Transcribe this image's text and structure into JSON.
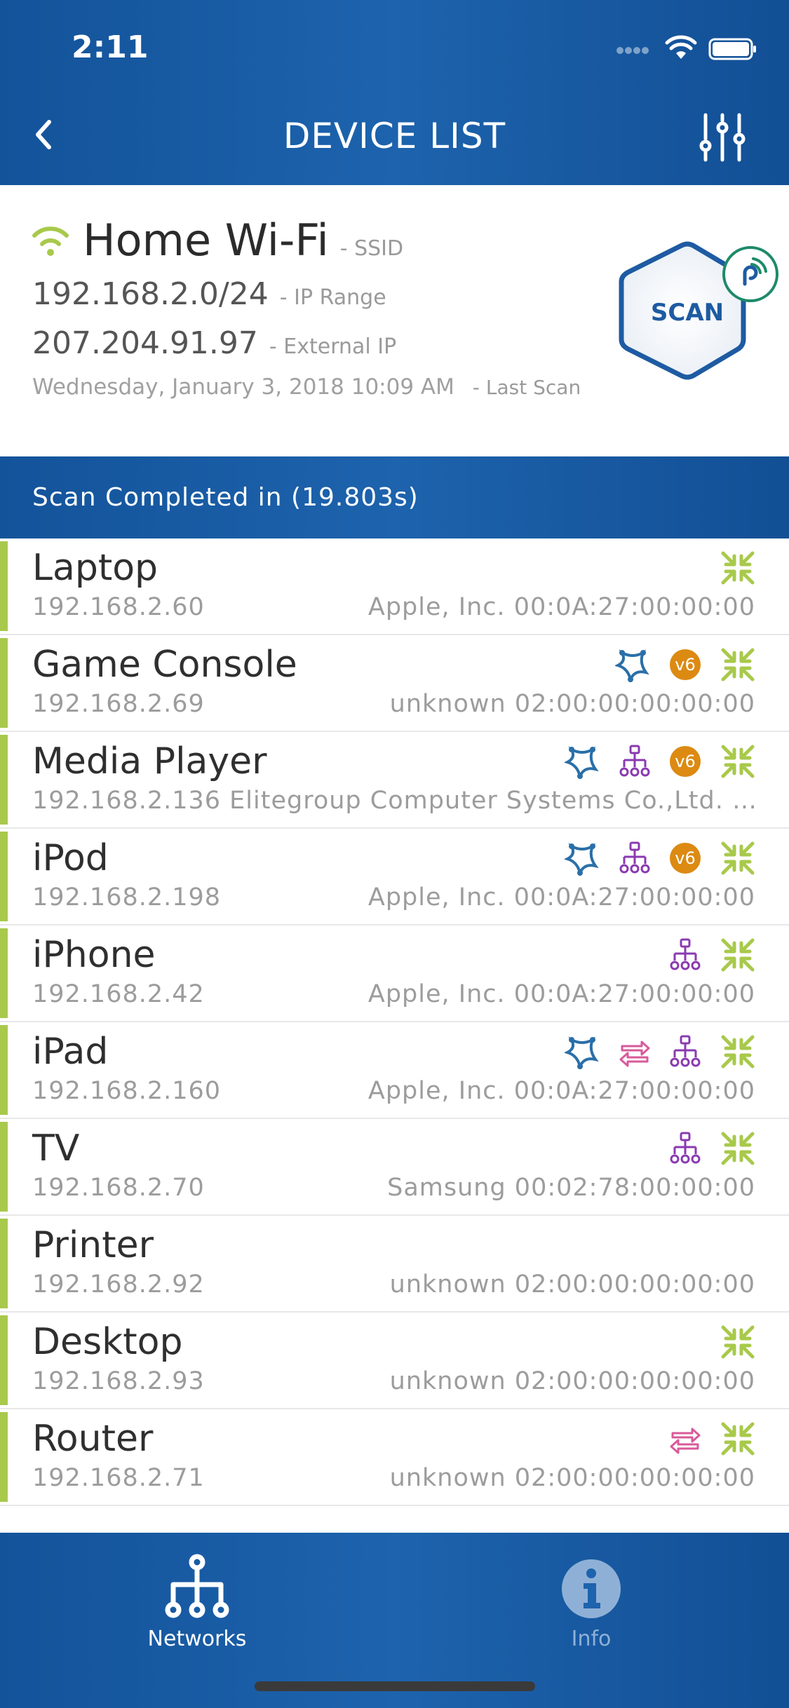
{
  "status_bar": {
    "time": "2:11"
  },
  "header": {
    "title": "DEVICE LIST"
  },
  "network": {
    "ssid": "Home Wi-Fi",
    "ssid_tag": "- SSID",
    "ip_range": "192.168.2.0/24",
    "ip_range_tag": "- IP Range",
    "external_ip": "207.204.91.97",
    "external_ip_tag": "- External IP",
    "last_scan": "Wednesday, January 3, 2018 10:09 AM",
    "last_scan_tag": "- Last Scan",
    "scan_button": "SCAN"
  },
  "scan_status": "Scan Completed in (19.803s)",
  "devices": [
    {
      "name": "Laptop",
      "ip": "192.168.2.60",
      "vendor": "Apple, Inc. 00:0A:27:00:00:00"
    },
    {
      "name": "Game Console",
      "ip": "192.168.2.69",
      "vendor": "unknown 02:00:00:00:00:00",
      "badge": "v6"
    },
    {
      "name": "Media Player",
      "detail": "192.168.2.136 Elitegroup Computer Systems Co.,Ltd. e…",
      "badge": "v6"
    },
    {
      "name": "iPod",
      "ip": "192.168.2.198",
      "vendor": "Apple, Inc. 00:0A:27:00:00:00",
      "badge": "v6"
    },
    {
      "name": "iPhone",
      "ip": "192.168.2.42",
      "vendor": "Apple, Inc. 00:0A:27:00:00:00"
    },
    {
      "name": "iPad",
      "ip": "192.168.2.160",
      "vendor": "Apple, Inc. 00:0A:27:00:00:00"
    },
    {
      "name": "TV",
      "ip": "192.168.2.70",
      "vendor": "Samsung 00:02:78:00:00:00"
    },
    {
      "name": "Printer",
      "ip": "192.168.2.92",
      "vendor": "unknown 02:00:00:00:00:00"
    },
    {
      "name": "Desktop",
      "ip": "192.168.2.93",
      "vendor": "unknown 02:00:00:00:00:00"
    },
    {
      "name": "Router",
      "ip": "192.168.2.71",
      "vendor": "unknown 02:00:00:00:00:00"
    }
  ],
  "tabs": [
    {
      "label": "Networks",
      "icon": "network-icon",
      "active": true
    },
    {
      "label": "Info",
      "icon": "info-icon",
      "active": false
    }
  ],
  "colors": {
    "header_blue": "#1d63ad",
    "accent_green": "#a8c94b",
    "ipv6_orange": "#dc8a12",
    "bonjour_blue": "#2a6fa8",
    "upnp_purple": "#8a3ab0",
    "transfer_pink": "#d85a9a"
  }
}
